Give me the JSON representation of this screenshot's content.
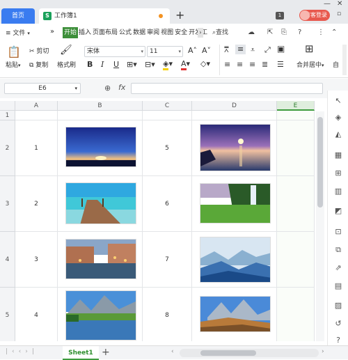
{
  "titlebar": {
    "home_tab": "首页",
    "doc_tab": "工作簿1",
    "doc_icon": "S",
    "new_tab": "+",
    "badge": "1",
    "visitor_login": "访客登录"
  },
  "menubar": {
    "hamburger": "≡",
    "file": "文件",
    "more": "»",
    "tabs": [
      "开始",
      "插入",
      "页面布局",
      "公式",
      "数据",
      "审阅",
      "视图",
      "安全",
      "开发工"
    ],
    "active_tab": 0,
    "search": "查找"
  },
  "ribbon": {
    "paste": "粘贴",
    "cut": "剪切",
    "copy": "复制",
    "format_painter": "格式刷",
    "font_name": "宋体",
    "font_size": "11",
    "bold": "B",
    "italic": "I",
    "underline": "U",
    "merge_center": "合并居中",
    "auto": "自"
  },
  "formula_bar": {
    "cell_ref": "E6",
    "fx": "fx",
    "value": ""
  },
  "grid": {
    "columns": [
      "A",
      "B",
      "C",
      "D",
      "E"
    ],
    "selected_column": "E",
    "rows": [
      {
        "num": "1",
        "a": "",
        "c": ""
      },
      {
        "num": "2",
        "a": "1",
        "c": "5"
      },
      {
        "num": "3",
        "a": "2",
        "c": "6"
      },
      {
        "num": "4",
        "a": "3",
        "c": "7"
      },
      {
        "num": "5",
        "a": "4",
        "c": "8"
      }
    ],
    "images_b": [
      "sunset-sky",
      "beach-pier",
      "venice-evening",
      "mountain-lake"
    ],
    "images_d": [
      "sea-sunset",
      "waterfall",
      "misty-mountains",
      "mountain-peaks"
    ]
  },
  "sheetbar": {
    "sheet_name": "Sheet1",
    "add_sheet": "+"
  },
  "colors": {
    "accent_green": "#3d9b3d",
    "home_blue": "#3a7cf0",
    "visitor_red": "#e8594e"
  }
}
